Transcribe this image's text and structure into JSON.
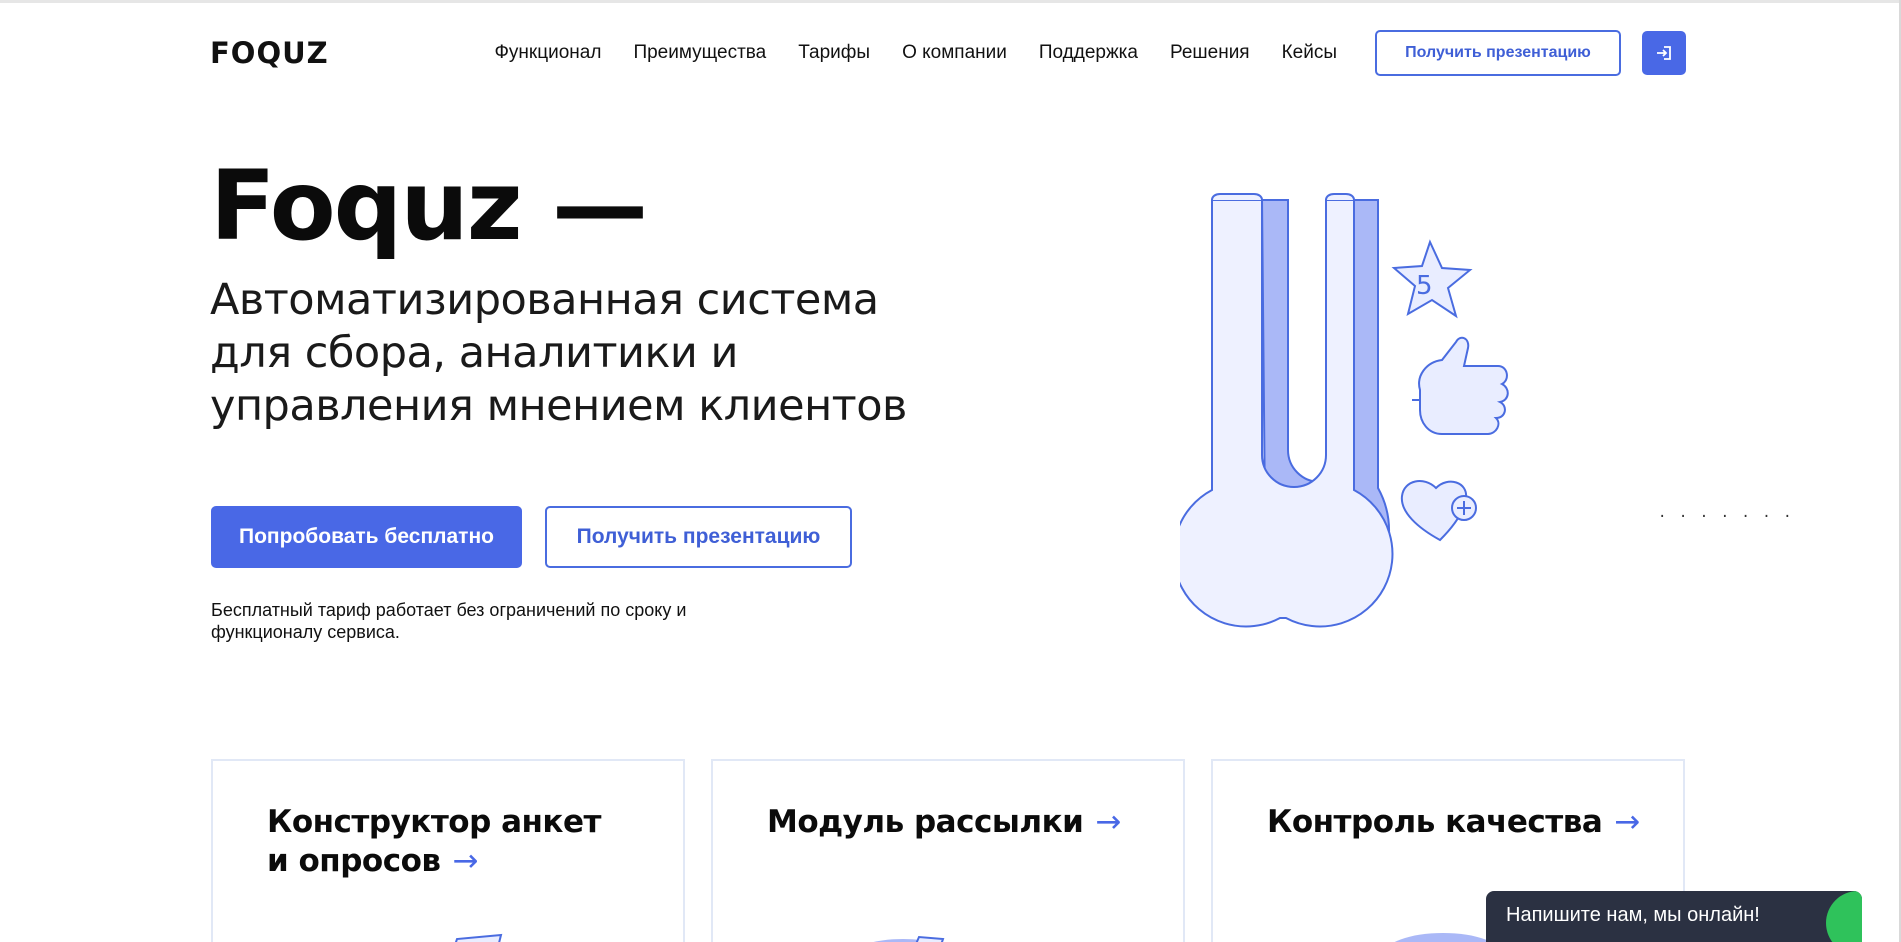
{
  "header": {
    "logo": "FOQUZ",
    "nav": [
      "Функционал",
      "Преимущества",
      "Тарифы",
      "О компании",
      "Поддержка",
      "Решения",
      "Кейсы"
    ],
    "presentation_button": "Получить презентацию",
    "login_icon": "login-icon"
  },
  "hero": {
    "title": "Foquz —",
    "subtitle_lines": [
      "Автоматизированная система",
      "для сбора, аналитики и",
      "управления мнением клиентов"
    ],
    "try_button": "Попробовать бесплатно",
    "presentation_button": "Получить презентацию",
    "note": "Бесплатный тариф работает без ограничений по сроку и функционалу сервиса.",
    "illustration": {
      "star_number": "5",
      "dots": ". . . .  . . ."
    }
  },
  "cards": [
    {
      "title_lines": [
        "Конструктор анкет",
        "и опросов"
      ],
      "arrow": "→"
    },
    {
      "title_lines": [
        "Модуль рассылки"
      ],
      "arrow": "→"
    },
    {
      "title_lines": [
        "Контроль качества"
      ],
      "arrow": "→"
    }
  ],
  "chat": {
    "text": "Напишите нам, мы онлайн!"
  },
  "colors": {
    "accent": "#4968e6",
    "illustration_fill": "#aab8f7",
    "illustration_stroke": "#4a6ce0",
    "chat_bg": "#2b3142",
    "chat_green": "#2fc25b"
  }
}
